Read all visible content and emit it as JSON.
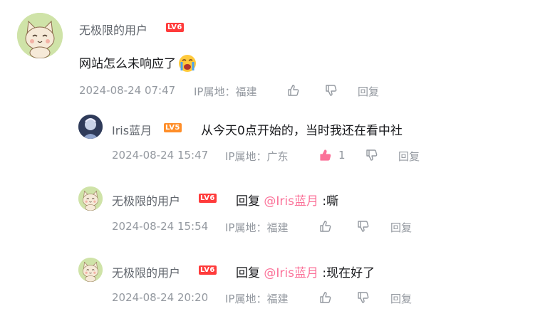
{
  "comment": {
    "username": "无极限的用户",
    "level": "LV6",
    "text": "网站怎么未响应了",
    "emoji": "crying-face-emoji",
    "time": "2024-08-24 07:47",
    "ip": "IP属地：福建",
    "reply_label": "回复"
  },
  "replies": [
    {
      "username": "Iris蓝月",
      "level": "LV5",
      "text": "从今天0点开始的，当时我还在看中社",
      "time": "2024-08-24 15:47",
      "ip": "IP属地：广东",
      "like_count": "1",
      "reply_label": "回复"
    },
    {
      "username": "无极限的用户",
      "level": "LV6",
      "prefix": "回复",
      "mention": "@Iris蓝月",
      "text": ":嘶",
      "time": "2024-08-24 15:54",
      "ip": "IP属地：福建",
      "reply_label": "回复"
    },
    {
      "username": "无极限的用户",
      "level": "LV6",
      "prefix": "回复",
      "mention": "@Iris蓝月",
      "text": ":现在好了",
      "time": "2024-08-24 20:20",
      "ip": "IP属地：福建",
      "reply_label": "回复"
    }
  ],
  "colors": {
    "accent_pink": "#fb7299",
    "meta_gray": "#9499a0",
    "lv6": "#ff3b3b",
    "lv5": "#ff8e29"
  }
}
